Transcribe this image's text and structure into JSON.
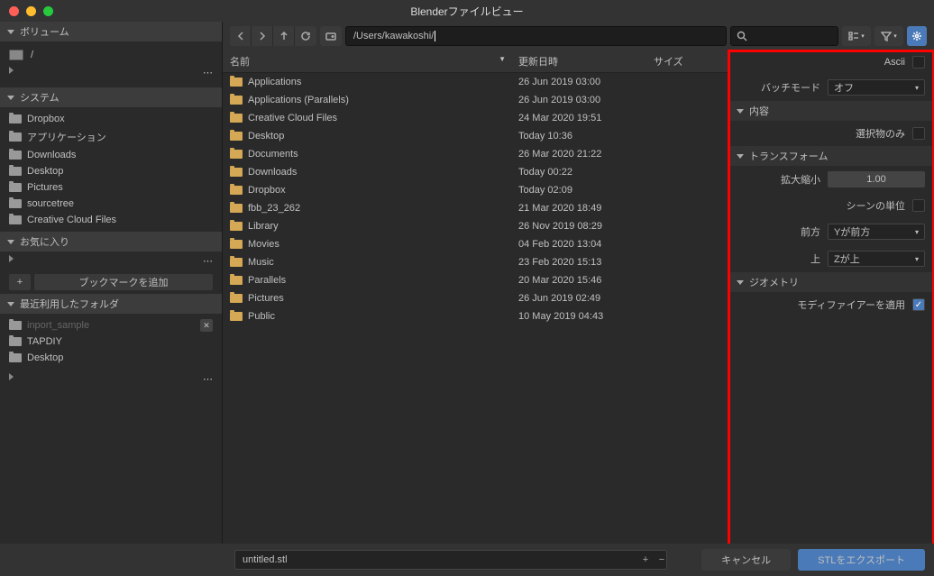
{
  "title": "Blenderファイルビュー",
  "sidebar": {
    "volume_h": "ボリューム",
    "volume_item": "/",
    "system_h": "システム",
    "system_items": [
      "Dropbox",
      "アプリケーション",
      "Downloads",
      "Desktop",
      "Pictures",
      "sourcetree",
      "Creative Cloud Files"
    ],
    "fav_h": "お気に入り",
    "bookmark_btn": "ブックマークを追加",
    "recent_h": "最近利用したフォルダ",
    "recent_items": [
      {
        "label": "inport_sample",
        "dim": true,
        "x": true
      },
      {
        "label": "TAPDIY",
        "dim": false
      },
      {
        "label": "Desktop",
        "dim": false
      }
    ]
  },
  "toolbar": {
    "path": "/Users/kawakoshi/"
  },
  "columns": {
    "name": "名前",
    "date": "更新日時",
    "size": "サイズ"
  },
  "files": [
    {
      "name": "Applications",
      "date": "26 Jun 2019 03:00"
    },
    {
      "name": "Applications (Parallels)",
      "date": "26 Jun 2019 03:00"
    },
    {
      "name": "Creative Cloud Files",
      "date": "24 Mar 2020 19:51"
    },
    {
      "name": "Desktop",
      "date": "Today 10:36"
    },
    {
      "name": "Documents",
      "date": "26 Mar 2020 21:22"
    },
    {
      "name": "Downloads",
      "date": "Today 00:22"
    },
    {
      "name": "Dropbox",
      "date": "Today 02:09"
    },
    {
      "name": "fbb_23_262",
      "date": "21 Mar 2020 18:49"
    },
    {
      "name": "Library",
      "date": "26 Nov 2019 08:29"
    },
    {
      "name": "Movies",
      "date": "04 Feb 2020 13:04"
    },
    {
      "name": "Music",
      "date": "23 Feb 2020 15:13"
    },
    {
      "name": "Parallels",
      "date": "20 Mar 2020 15:46"
    },
    {
      "name": "Pictures",
      "date": "26 Jun 2019 02:49"
    },
    {
      "name": "Public",
      "date": "10 May 2019 04:43"
    }
  ],
  "options": {
    "ascii": "Ascii",
    "batch_label": "バッチモード",
    "batch_val": "オフ",
    "content_h": "内容",
    "selection_only": "選択物のみ",
    "transform_h": "トランスフォーム",
    "scale_label": "拡大縮小",
    "scale_val": "1.00",
    "scene_unit": "シーンの単位",
    "forward_label": "前方",
    "forward_val": "Yが前方",
    "up_label": "上",
    "up_val": "Zが上",
    "geometry_h": "ジオメトリ",
    "apply_mod": "モディファイアーを適用"
  },
  "footer": {
    "filename": "untitled.stl",
    "cancel": "キャンセル",
    "export": "STLをエクスポート"
  }
}
